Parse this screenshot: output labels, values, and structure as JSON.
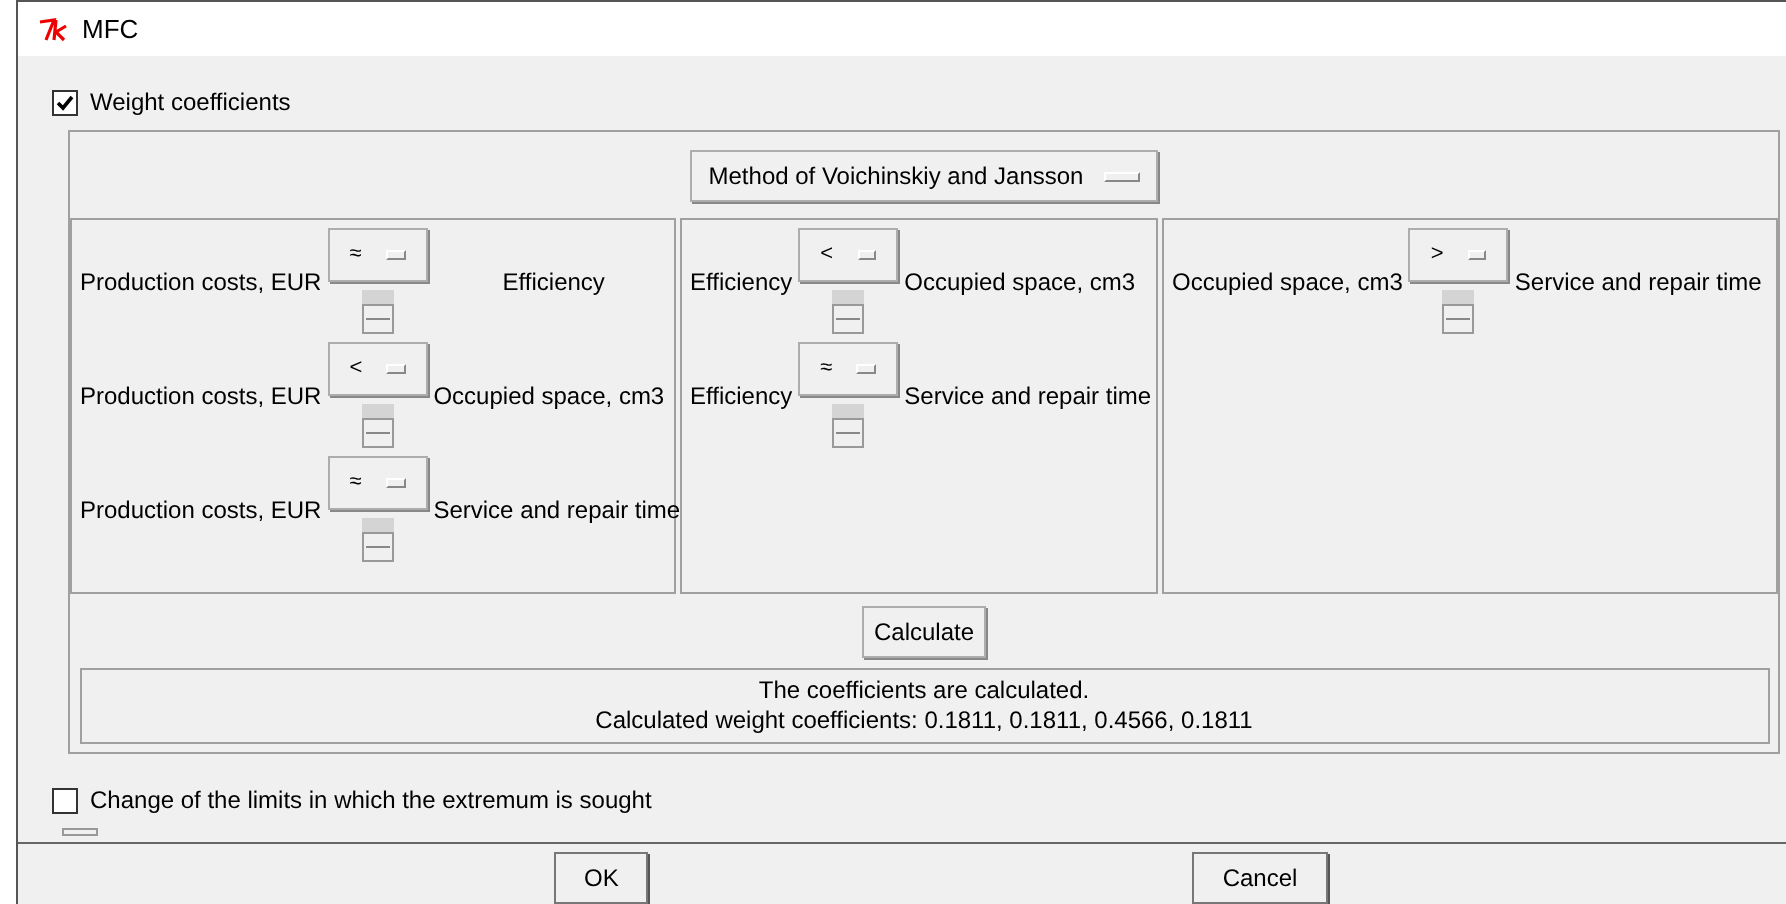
{
  "window": {
    "title": "MFC"
  },
  "weight_coefficients": {
    "label": "Weight coefficients",
    "checked": true
  },
  "method_button": "Method of Voichinskiy and Jansson",
  "panels": [
    {
      "rows": [
        {
          "left": "Production costs, EUR",
          "relation": "≈",
          "right": "Efficiency"
        },
        {
          "left": "Production costs, EUR",
          "relation": "<",
          "right": "Occupied space, cm3"
        },
        {
          "left": "Production costs, EUR",
          "relation": "≈",
          "right": "Service and repair time"
        }
      ]
    },
    {
      "rows": [
        {
          "left": "Efficiency",
          "relation": "<",
          "right": "Occupied space, cm3"
        },
        {
          "left": "Efficiency",
          "relation": "≈",
          "right": "Service and repair time"
        }
      ]
    },
    {
      "rows": [
        {
          "left": "Occupied space, cm3",
          "relation": ">",
          "right": "Service and repair time"
        }
      ]
    }
  ],
  "calculate_button": "Calculate",
  "result_lines": [
    "The coefficients are calculated.",
    "Calculated weight coefficients: 0.1811, 0.1811, 0.4566, 0.1811"
  ],
  "limits": {
    "label": "Change of the limits in which the extremum is sought",
    "checked": false
  },
  "buttons": [
    "OK",
    "Cancel"
  ]
}
